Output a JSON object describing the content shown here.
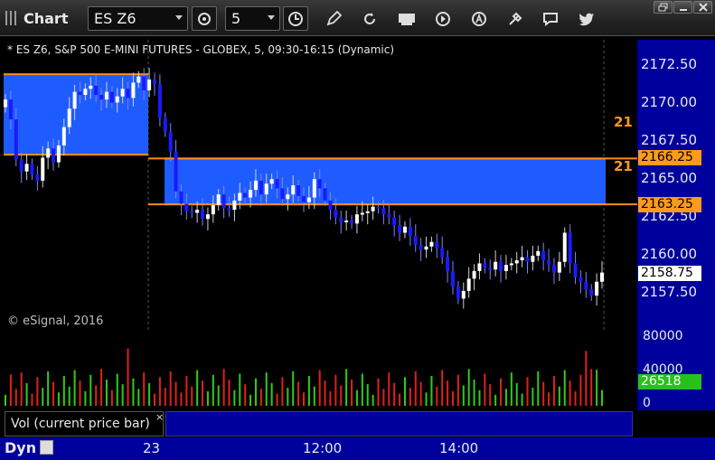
{
  "toolbar": {
    "title": "Chart",
    "symbol": "ES Z6",
    "interval": "5",
    "icons": [
      "link-icon",
      "interval-clock-icon",
      "draw-pencil-icon",
      "refresh-icon",
      "get-data-icon",
      "play-icon",
      "alert-icon",
      "tools-icon",
      "comment-icon",
      "twitter-icon"
    ]
  },
  "window": {
    "buttons": [
      "restore",
      "minimize",
      "close"
    ]
  },
  "chart": {
    "header": "* ES Z6, S&P 500 E-MINI FUTURES - GLOBEX, 5, 09:30-16:15 (Dynamic)",
    "copyright": "© eSignal, 2016",
    "price_ticks": [
      "2172.50",
      "2170.00",
      "2167.50",
      "2165.00",
      "2162.50",
      "2160.00",
      "2157.50"
    ],
    "price_labels": {
      "upper_level": "2166.25",
      "lower_level": "2163.25",
      "last": "2158.75"
    },
    "level_tags": {
      "upper": "21",
      "lower": "21"
    },
    "volume_ticks": [
      "80000",
      "40000",
      "0"
    ],
    "volume_last": "26518",
    "volume_legend": "Vol (current price bar)",
    "time_ticks": [
      "23",
      "12:00",
      "14:00"
    ],
    "dynamic_label": "Dyn",
    "colors": {
      "up": "#ffffff",
      "down": "#1a1aff",
      "band": "#1f5cff",
      "level": "#ff8c1a",
      "vol_up": "#2ecc1a",
      "vol_down": "#e02020",
      "axis_bg": "#00009c"
    }
  },
  "chart_data": {
    "type": "candlestick",
    "ylim": [
      2155.0,
      2174.0
    ],
    "yticks": [
      2157.5,
      2160.0,
      2162.5,
      2165.0,
      2167.5,
      2170.0,
      2172.5
    ],
    "x": [
      "23",
      "12:00",
      "14:00"
    ],
    "zones": [
      {
        "high": 2171.75,
        "low": 2166.5
      },
      {
        "high": 2166.25,
        "low": 2163.25
      }
    ],
    "last_price": 2158.75,
    "candles_close": [
      2170.1,
      2168.8,
      2166.2,
      2165.4,
      2165.9,
      2165.2,
      2164.8,
      2166.3,
      2166.9,
      2166.0,
      2167.1,
      2168.3,
      2169.5,
      2170.6,
      2170.4,
      2170.8,
      2171.0,
      2170.4,
      2170.1,
      2170.6,
      2169.9,
      2170.3,
      2170.8,
      2170.2,
      2171.2,
      2171.6,
      2170.7,
      2171.4,
      2171.1,
      2168.9,
      2168.0,
      2166.7,
      2164.1,
      2163.3,
      2162.8,
      2162.7,
      2162.9,
      2162.3,
      2162.6,
      2163.2,
      2163.9,
      2163.0,
      2162.9,
      2163.5,
      2164.0,
      2163.7,
      2164.2,
      2164.8,
      2163.9,
      2164.6,
      2164.9,
      2164.3,
      2163.6,
      2163.9,
      2164.5,
      2163.8,
      2163.4,
      2163.7,
      2164.9,
      2164.3,
      2163.5,
      2162.9,
      2162.4,
      2162.1,
      2162.2,
      2162.0,
      2162.6,
      2162.7,
      2162.8,
      2163.1,
      2163.0,
      2162.6,
      2162.4,
      2161.9,
      2161.4,
      2161.8,
      2161.2,
      2160.6,
      2160.3,
      2160.5,
      2160.8,
      2160.4,
      2159.8,
      2158.9,
      2157.9,
      2157.1,
      2157.6,
      2158.4,
      2158.9,
      2159.4,
      2159.1,
      2159.0,
      2159.5,
      2158.9,
      2159.3,
      2159.4,
      2159.6,
      2159.8,
      2159.5,
      2159.9,
      2160.2,
      2159.6,
      2159.3,
      2158.8,
      2159.5,
      2161.4,
      2159.4,
      2158.5,
      2158.2,
      2157.7,
      2157.3,
      2158.2,
      2158.8
    ]
  }
}
